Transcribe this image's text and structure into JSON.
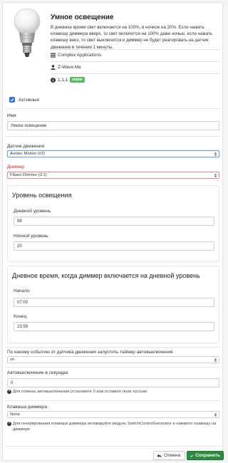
{
  "app": {
    "title": "Умное освещение",
    "description": "В дневное время свет включается на 100%, в ночное на 20%. Если нажать клавишу диммера вверх, то свет включится на 100% даже ночью, если нажать клавишу вниз, то свет выключится и диммер не будет реагировать на датчик движения в течении 1 минуты.",
    "category": "Complex Applications",
    "author": "Z-Wave.Me",
    "version": "1.1.1",
    "status_badge": "stable",
    "icon": "light-bulb-icon"
  },
  "active": {
    "label": "Активные",
    "checked": true
  },
  "fields": {
    "name": {
      "label": "Имя",
      "value": "Умное освещение"
    },
    "motion_sensor": {
      "label": "Датчик движения",
      "value": "Aeotec Motion (#2)"
    },
    "dimmer": {
      "label": "Диммер",
      "value": "Fibaro Dimmer (3.1)"
    }
  },
  "light_level": {
    "title": "Уровень освещения",
    "day": {
      "label": "Дневной уровень",
      "value": "99"
    },
    "night": {
      "label": "Ночной уровень",
      "value": "20"
    }
  },
  "daytime": {
    "title": "Дневное время, когда диммер включается на дневной уровень",
    "start": {
      "label": "Начало",
      "value": "07:00"
    },
    "end": {
      "label": "Конец",
      "value": "23:59"
    }
  },
  "timer_event": {
    "label": "По какому событию от датчика движения запустить таймер автовыключения",
    "value": "on"
  },
  "auto_off": {
    "label": "Автовыключение в секундах",
    "value": "0",
    "help": "Для отмены автовыключения установите 0 или оставьте поле пустым"
  },
  "dimmer_key": {
    "label": "Клавиша диммера",
    "value": "None",
    "help": "Для генерирования клавиши диммера активируйте модуль SwitchControlGenerator и нажмите клавишу на диммере"
  },
  "buttons": {
    "cancel": "Отмена",
    "save": "Сохранить"
  },
  "colors": {
    "accent": "#2f72d7",
    "save": "#2e8b3e",
    "required": "#d9302b"
  }
}
